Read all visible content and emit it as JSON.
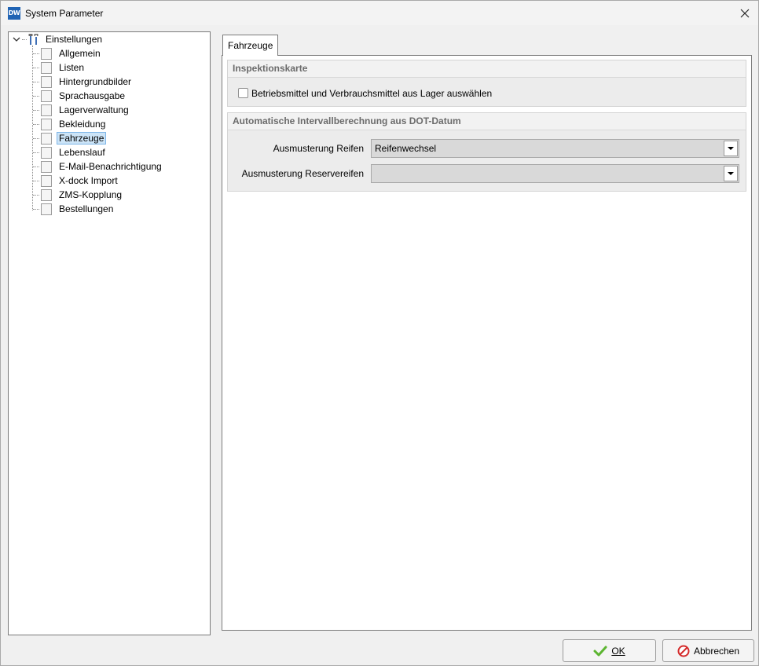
{
  "window": {
    "title": "System Parameter",
    "app_icon_text": "DW"
  },
  "tree": {
    "root": {
      "label": "Einstellungen",
      "icon": "tools-icon",
      "expanded": true
    },
    "items": [
      {
        "label": "Allgemein"
      },
      {
        "label": "Listen"
      },
      {
        "label": "Hintergrundbilder"
      },
      {
        "label": "Sprachausgabe"
      },
      {
        "label": "Lagerverwaltung"
      },
      {
        "label": "Bekleidung"
      },
      {
        "label": "Fahrzeuge",
        "selected": true
      },
      {
        "label": "Lebenslauf"
      },
      {
        "label": "E-Mail-Benachrichtigung"
      },
      {
        "label": "X-dock Import"
      },
      {
        "label": "ZMS-Kopplung"
      },
      {
        "label": "Bestellungen"
      }
    ]
  },
  "tab": {
    "label": "Fahrzeuge"
  },
  "inspektion": {
    "header": "Inspektionskarte",
    "checkbox_label": "Betriebsmittel und Verbrauchsmittel aus Lager auswählen",
    "checked": false
  },
  "intervall": {
    "header": "Automatische Intervallberechnung aus DOT-Datum",
    "reifen_label": "Ausmusterung Reifen",
    "reifen_value": "Reifenwechsel",
    "reserve_label": "Ausmusterung Reservereifen",
    "reserve_value": ""
  },
  "buttons": {
    "ok_label": "OK",
    "cancel_label": "Abbrechen"
  },
  "colors": {
    "selection": "#cce4f7",
    "ok_icon": "#5cb531",
    "cancel_icon": "#d42a2a"
  }
}
